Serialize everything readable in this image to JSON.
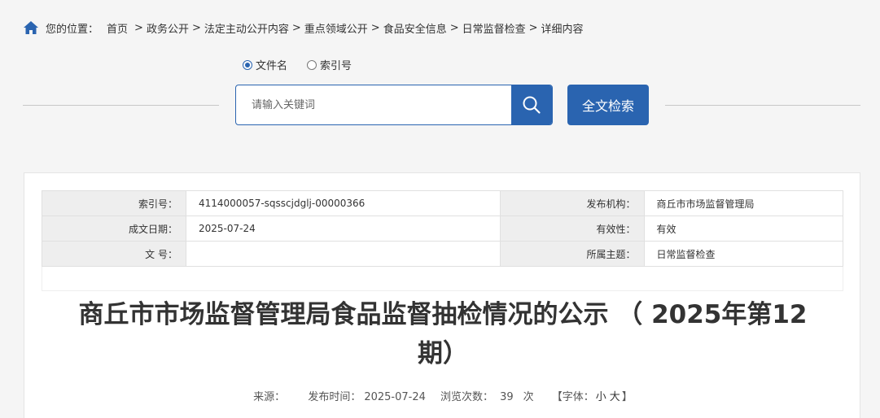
{
  "breadcrumb": {
    "label": "您的位置：",
    "items": [
      "首页",
      "政务公开",
      "法定主动公开内容",
      "重点领域公开",
      "食品安全信息",
      "日常监督检查",
      "详细内容"
    ],
    "separator": ">"
  },
  "search": {
    "options": [
      {
        "label": "文件名",
        "checked": true
      },
      {
        "label": "索引号",
        "checked": false
      }
    ],
    "placeholder": "请输入关键词",
    "value": "",
    "fulltext_label": "全文检索"
  },
  "meta": {
    "index_label": "索引号：",
    "index_value": "4114000057-sqsscjdglj-00000366",
    "publisher_label": "发布机构：",
    "publisher_value": "商丘市市场监督管理局",
    "date_label": "成文日期：",
    "date_value": "2025-07-24",
    "validity_label": "有效性：",
    "validity_value": "有效",
    "docno_label": "文 号：",
    "docno_value": "",
    "topic_label": "所属主题：",
    "topic_value": "日常监督检查"
  },
  "article": {
    "title": "商丘市市场监督管理局食品监督抽检情况的公示 （ 2025年第12期）",
    "source_label": "来源：",
    "source_value": "",
    "publish_label": "发布时间：",
    "publish_value": "2025-07-24",
    "views_label": "浏览次数：",
    "views_value": "39",
    "views_unit": "次",
    "font_label": "【字体：",
    "font_small": "小",
    "font_large": "大",
    "font_close": "】"
  },
  "colors": {
    "accent": "#2a64b0",
    "page_bg": "#f5f5f5",
    "label_bg": "#eeeeee"
  }
}
